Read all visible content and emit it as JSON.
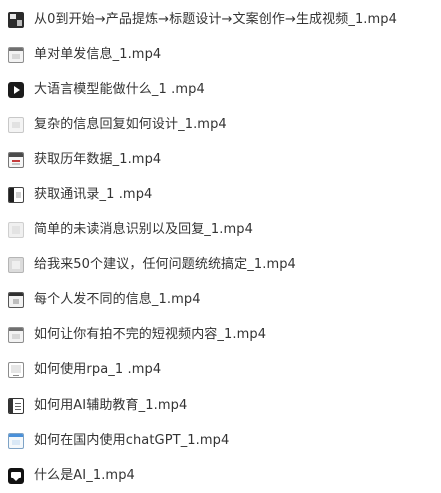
{
  "files": [
    {
      "name": "从0到开始→产品提炼→标题设计→文案创作→生成视频_1.mp4",
      "icon": "collage-video-thumbnail-icon"
    },
    {
      "name": "单对单发信息_1.mp4",
      "icon": "window-video-thumbnail-icon"
    },
    {
      "name": "大语言模型能做什么_1 .mp4",
      "icon": "play-video-thumbnail-icon"
    },
    {
      "name": "复杂的信息回复如何设计_1.mp4",
      "icon": "light-video-thumbnail-icon"
    },
    {
      "name": "获取历年数据_1.mp4",
      "icon": "table-video-thumbnail-icon"
    },
    {
      "name": "获取通讯录_1 .mp4",
      "icon": "book-video-thumbnail-icon"
    },
    {
      "name": "简单的未读消息识别以及回复_1.mp4",
      "icon": "pale-video-thumbnail-icon"
    },
    {
      "name": "给我来50个建议，任何问题统统搞定_1.mp4",
      "icon": "grey-video-thumbnail-icon"
    },
    {
      "name": "每个人发不同的信息_1.mp4",
      "icon": "dark-frame-video-thumbnail-icon"
    },
    {
      "name": "如何让你有拍不完的短视频内容_1.mp4",
      "icon": "window-video-thumbnail-icon"
    },
    {
      "name": "如何使用rpa_1 .mp4",
      "icon": "screen-video-thumbnail-icon"
    },
    {
      "name": "如何用AI辅助教育_1.mp4",
      "icon": "document-video-thumbnail-icon"
    },
    {
      "name": "如何在国内使用chatGPT_1.mp4",
      "icon": "blue-video-thumbnail-icon"
    },
    {
      "name": "什么是AI_1.mp4",
      "icon": "chat-video-thumbnail-icon"
    }
  ]
}
